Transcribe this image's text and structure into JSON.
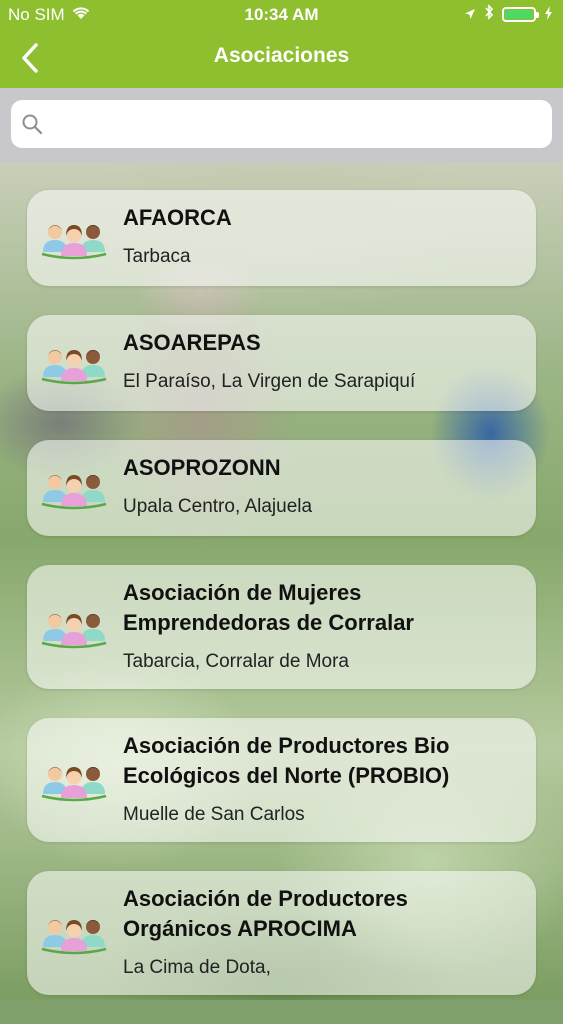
{
  "status_bar": {
    "carrier": "No SIM",
    "time": "10:34 AM",
    "icons": [
      "wifi-icon",
      "location-icon",
      "bluetooth-icon",
      "battery-icon",
      "charging-icon"
    ]
  },
  "nav": {
    "title": "Asociaciones",
    "back_icon": "chevron-left-icon"
  },
  "search": {
    "placeholder": "",
    "value": ""
  },
  "colors": {
    "brand_green": "#8dbf2e",
    "search_bg": "#c7c7cc"
  },
  "associations": [
    {
      "name": "AFAORCA",
      "location": "Tarbaca"
    },
    {
      "name": "ASOAREPAS",
      "location": "El Paraíso, La Virgen de Sarapiquí"
    },
    {
      "name": "ASOPROZONN",
      "location": "Upala Centro, Alajuela"
    },
    {
      "name": "Asociación de Mujeres Emprendedoras de Corralar",
      "location": "Tabarcia, Corralar de Mora"
    },
    {
      "name": "Asociación de Productores Bio Ecológicos del Norte (PROBIO)",
      "location": "Muelle de San Carlos"
    },
    {
      "name": "Asociación de Productores Orgánicos APROCIMA",
      "location": "La Cima de Dota,"
    }
  ]
}
